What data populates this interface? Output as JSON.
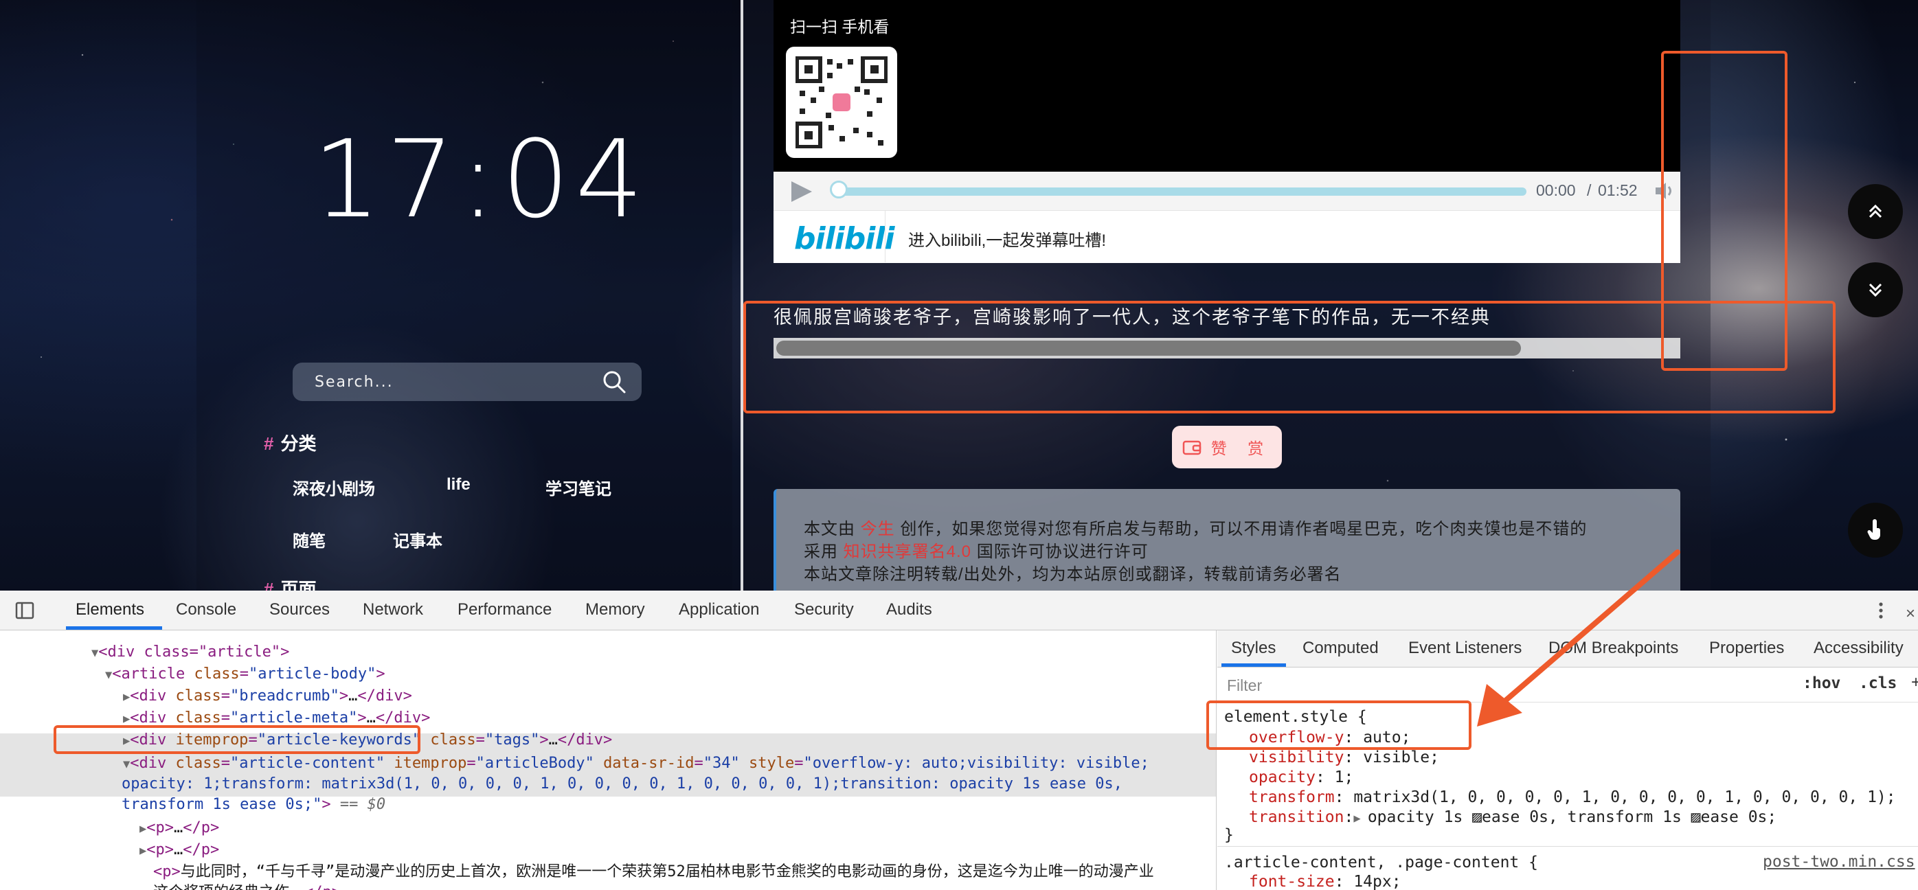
{
  "page": {
    "clock": "17:04",
    "search_placeholder": "Search...",
    "categories": {
      "heading": "分类",
      "items": [
        "深夜小剧场",
        "life",
        "学习笔记",
        "随笔",
        "记事本"
      ]
    },
    "pages_heading": "页面",
    "video": {
      "qr_title": "扫一扫 手机看",
      "time_current": "00:00",
      "time_separator": "/",
      "time_total": "01:52",
      "bilibili_logo": "bilibili",
      "bilibili_cta": "进入bilibili,一起发弹幕吐槽!"
    },
    "quote": "很佩服宫崎骏老爷子，宫崎骏影响了一代人，这个老爷子笔下的作品，无一不经典",
    "reward_label": "赞 赏",
    "license": {
      "line1_pre": "本文由 ",
      "author": "今生",
      "line1_post": " 创作，如果您觉得对您有所启发与帮助，可以不用请作者喝星巴克，吃个肉夹馍也是不错的",
      "line2_pre": "采用 ",
      "license_name": "知识共享署名4.0",
      "line2_post": " 国际许可协议进行许可",
      "line3": "本站文章除注明转载/出处外，均为本站原创或翻译，转载前请务必署名"
    }
  },
  "devtools": {
    "tabs": [
      "Elements",
      "Console",
      "Sources",
      "Network",
      "Performance",
      "Memory",
      "Application",
      "Security",
      "Audits"
    ],
    "active_tab": "Elements",
    "elements": {
      "line0": "<div class=\"article\">",
      "article_tag": "article",
      "article_class": "article-body",
      "breadcrumb_class": "breadcrumb",
      "meta_class": "article-meta",
      "keywords_itemprop": "article-keywords",
      "keywords_class": "tags",
      "selected_class": "article-content",
      "selected_itemprop": "articleBody",
      "selected_srid": "34",
      "selected_style_1": "overflow-y: auto;visibility: visible;",
      "selected_style_2": "opacity: 1;transform: matrix3d(1, 0, 0, 0, 0, 1, 0, 0, 0, 0, 1, 0, 0, 0, 0, 1);transition: opacity 1s ease 0s,",
      "selected_style_3": "transform 1s ease 0s;",
      "selected_suffix": " == $0",
      "p_collapsed": "…",
      "p_text_1": "与此同时，“千与千寻”是动漫产业的历史上首次，欧洲是唯一一个荣获第52届柏林电影节金熊奖的电影动画的身份，这是迄今为止唯一的动漫产业",
      "p_text_2": "这个奖项的经典之作。"
    },
    "styles": {
      "tabs": [
        "Styles",
        "Computed",
        "Event Listeners",
        "DOM Breakpoints",
        "Properties",
        "Accessibility"
      ],
      "active_tab": "Styles",
      "filter_placeholder": "Filter",
      "hov": ":hov",
      "cls": ".cls",
      "plus": "+",
      "element_style_selector": "element.style {",
      "props": [
        {
          "name": "overflow-y",
          "value": "auto;"
        },
        {
          "name": "visibility",
          "value": "visible;"
        },
        {
          "name": "opacity",
          "value": "1;"
        },
        {
          "name": "transform",
          "value": "matrix3d(1, 0, 0, 0, 0, 1, 0, 0, 0, 0, 1, 0, 0, 0, 0, 1);"
        },
        {
          "name": "transition",
          "value": "opacity 1s ▨ease 0s, transform 1s ▨ease 0s;"
        }
      ],
      "closing_brace": "}",
      "next_rule_selector": ".article-content, .page-content {",
      "next_rule_source": "post-two.min.css",
      "next_rule_prop": "font-size",
      "next_rule_value": "14px;"
    }
  },
  "colors": {
    "annotation": "#ee5a2b",
    "accent_blue": "#1a73e8",
    "player_progress": "#a8dbe8",
    "bilibili_blue": "#00a1d6",
    "hash_pink": "#e05fa8"
  }
}
